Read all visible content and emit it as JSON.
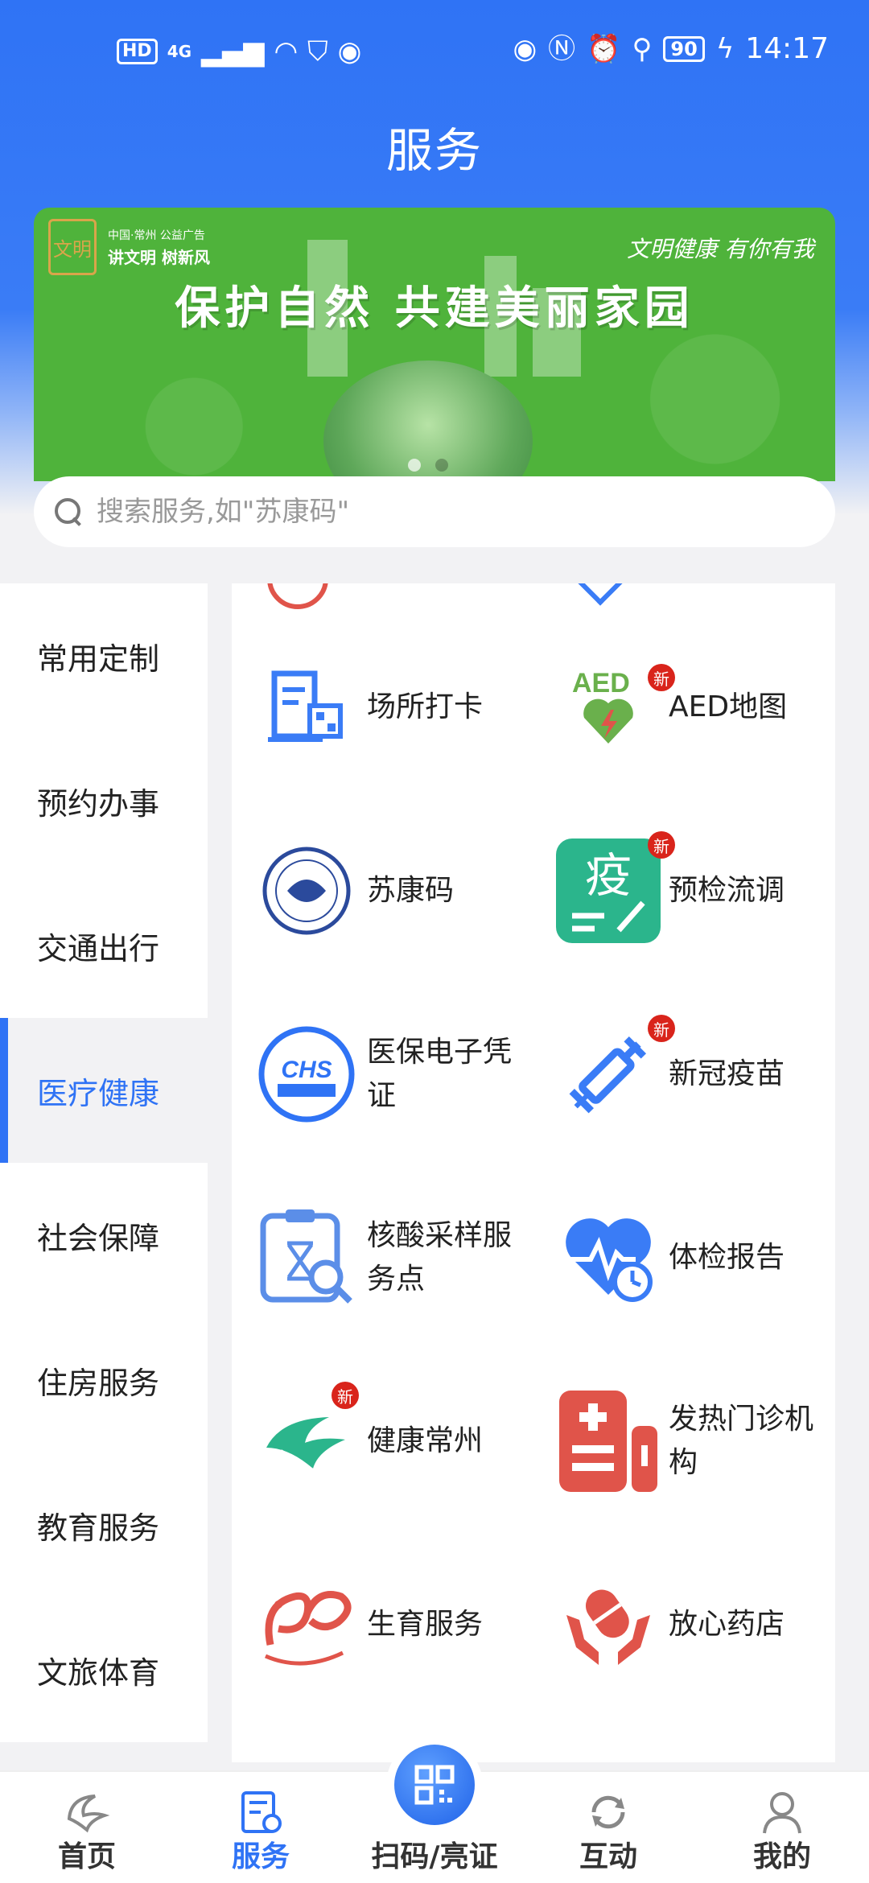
{
  "status_bar": {
    "hd_label": "HD",
    "signal_label": "4G",
    "battery": "90",
    "time": "14:17"
  },
  "header": {
    "title": "服务"
  },
  "banner": {
    "logo_text": "文明",
    "sub_line1": "中国·常州  公益广告",
    "sub_line2": "讲文明 树新风",
    "slogan": "文明健康 有你有我",
    "headline": "保护自然  共建美丽家园"
  },
  "search": {
    "placeholder": "搜索服务,如\"苏康码\""
  },
  "sidebar": {
    "items": [
      {
        "label": "常用定制"
      },
      {
        "label": "预约办事"
      },
      {
        "label": "交通出行"
      },
      {
        "label": "医疗健康"
      },
      {
        "label": "社会保障"
      },
      {
        "label": "住房服务"
      },
      {
        "label": "教育服务"
      },
      {
        "label": "文旅体育"
      }
    ],
    "active_index": 3
  },
  "services": [
    {
      "label": "场所打卡",
      "icon": "venue-checkin-icon",
      "new": false
    },
    {
      "label": "AED地图",
      "icon": "aed-map-icon",
      "new": true,
      "icon_text": "AED"
    },
    {
      "label": "苏康码",
      "icon": "sukang-code-icon",
      "new": false
    },
    {
      "label": "预检流调",
      "icon": "epidemic-precheck-icon",
      "new": true,
      "icon_text": "疫"
    },
    {
      "label": "医保电子凭证",
      "icon": "medical-insurance-icon",
      "new": false,
      "icon_text": "CHS"
    },
    {
      "label": "新冠疫苗",
      "icon": "vaccine-syringe-icon",
      "new": true
    },
    {
      "label": "核酸采样服务点",
      "icon": "nucleic-test-icon",
      "new": false
    },
    {
      "label": "体检报告",
      "icon": "health-report-icon",
      "new": false
    },
    {
      "label": "健康常州",
      "icon": "healthy-changzhou-icon",
      "new": true
    },
    {
      "label": "发热门诊机构",
      "icon": "fever-clinic-icon",
      "new": false
    },
    {
      "label": "生育服务",
      "icon": "fertility-service-icon",
      "new": false
    },
    {
      "label": "放心药店",
      "icon": "pharmacy-icon",
      "new": false
    }
  ],
  "new_badge_text": "新",
  "bottom_nav": {
    "tabs": [
      {
        "label": "首页",
        "icon": "home-icon"
      },
      {
        "label": "服务",
        "icon": "service-icon"
      },
      {
        "label": "扫码/亮证",
        "icon": "scan-qr-icon"
      },
      {
        "label": "互动",
        "icon": "interact-icon"
      },
      {
        "label": "我的",
        "icon": "profile-icon"
      }
    ],
    "active_index": 1
  },
  "colors": {
    "primary": "#2f73f5",
    "banner_green": "#4fb33b",
    "badge_red": "#d9241b",
    "icon_blue": "#3a7cf6",
    "icon_teal": "#2bb58c",
    "icon_red": "#e0544a"
  }
}
